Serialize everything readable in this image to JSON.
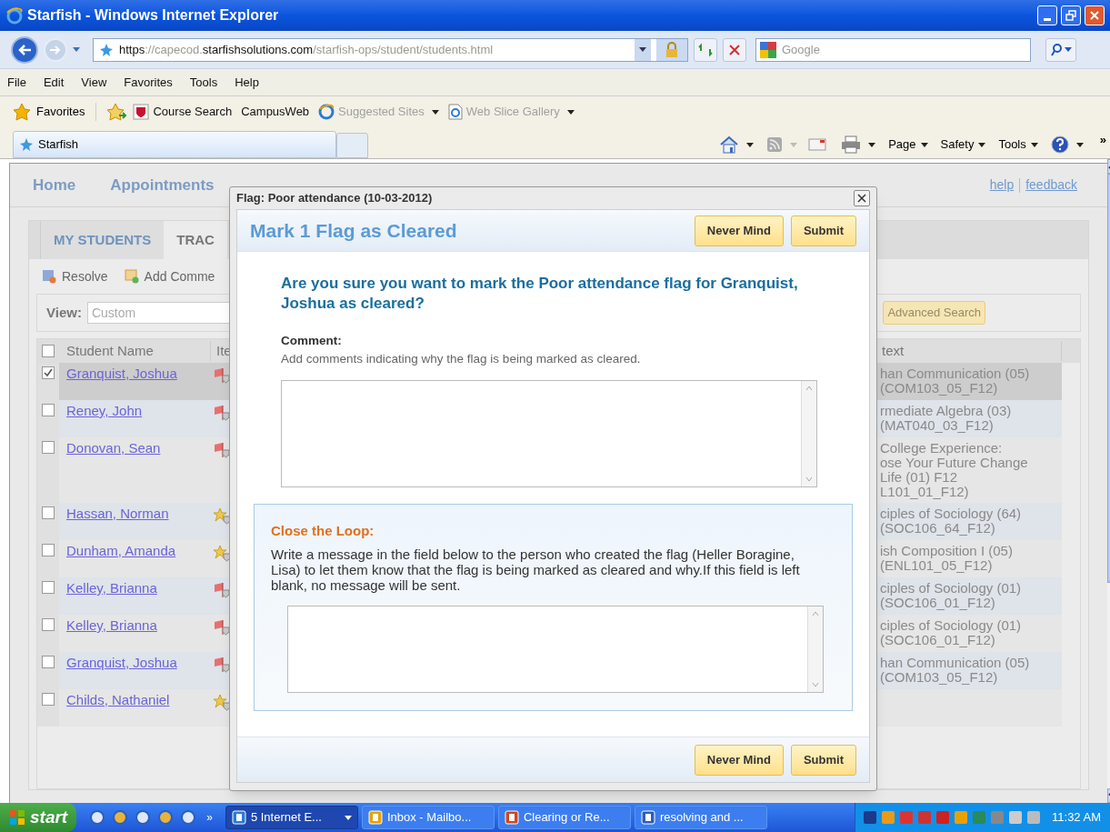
{
  "browser": {
    "title": "Starfish - Windows Internet Explorer",
    "address": [
      {
        "text": "https",
        "emphasis": true
      },
      {
        "text": "://capecod.",
        "emphasis": false
      },
      {
        "text": "starfishsolutions.com",
        "emphasis": true
      },
      {
        "text": "/starfish-ops/student/students.html",
        "emphasis": false
      }
    ],
    "search_placeholder": "Google",
    "menu": [
      "File",
      "Edit",
      "View",
      "Favorites",
      "Tools",
      "Help"
    ],
    "favorites_label": "Favorites",
    "favorites": [
      {
        "label": "Course Search",
        "kind": "shield",
        "disabled": false,
        "dropdown": false
      },
      {
        "label": "CampusWeb",
        "kind": "plain",
        "disabled": false,
        "dropdown": false
      },
      {
        "label": "Suggested Sites",
        "kind": "ie",
        "disabled": true,
        "dropdown": true
      },
      {
        "label": "Web Slice Gallery",
        "kind": "page",
        "disabled": true,
        "dropdown": true
      }
    ],
    "tabs": [
      {
        "label": "Starfish",
        "selected": true
      }
    ],
    "commands": [
      "Page",
      "Safety",
      "Tools"
    ],
    "overflow": "»"
  },
  "page": {
    "nav": [
      "Home",
      "Appointments"
    ],
    "links": [
      "help",
      "feedback"
    ],
    "tabs": [
      {
        "label": "MY STUDENTS",
        "selected": false
      },
      {
        "label": "TRAC",
        "selected": true
      }
    ],
    "actions": [
      {
        "label": "Resolve",
        "kind": "resolve"
      },
      {
        "label": "Add Comme",
        "kind": "comment"
      }
    ],
    "select_all_checked": false,
    "view_label": "View:",
    "view_value": "Custom",
    "advanced_search": "Advanced Search",
    "columns": [
      "Student Name",
      "Ite",
      "text"
    ],
    "rows": [
      {
        "name": "Granquist, Joshua",
        "checked": true,
        "selected": true,
        "kind": "flag",
        "context": [
          "han Communication (05)",
          "(COM103_05_F12)"
        ]
      },
      {
        "name": "Reney, John",
        "checked": false,
        "selected": false,
        "kind": "flag",
        "context": [
          "rmediate Algebra (03)",
          "(MAT040_03_F12)"
        ]
      },
      {
        "name": "Donovan, Sean",
        "checked": false,
        "selected": false,
        "kind": "flag",
        "context": [
          "College Experience:",
          "ose Your Future Change",
          "Life (01) F12",
          "L101_01_F12)"
        ]
      },
      {
        "name": "Hassan, Norman",
        "checked": false,
        "selected": false,
        "kind": "kudos",
        "context": [
          "ciples of Sociology (64)",
          "(SOC106_64_F12)"
        ]
      },
      {
        "name": "Dunham, Amanda",
        "checked": false,
        "selected": false,
        "kind": "kudos",
        "context": [
          "ish Composition I (05)",
          "(ENL101_05_F12)"
        ]
      },
      {
        "name": "Kelley, Brianna",
        "checked": false,
        "selected": false,
        "kind": "flag",
        "context": [
          "ciples of Sociology (01)",
          "(SOC106_01_F12)"
        ]
      },
      {
        "name": "Kelley, Brianna",
        "checked": false,
        "selected": false,
        "kind": "flag",
        "context": [
          "ciples of Sociology (01)",
          "(SOC106_01_F12)"
        ]
      },
      {
        "name": "Granquist, Joshua",
        "checked": false,
        "selected": false,
        "kind": "flag",
        "context": [
          "han Communication (05)",
          "(COM103_05_F12)"
        ]
      },
      {
        "name": "Childs, Nathaniel",
        "checked": false,
        "selected": false,
        "kind": "kudos",
        "context": []
      }
    ]
  },
  "dialog": {
    "title": "Flag: Poor attendance (10-03-2012)",
    "heading": "Mark 1 Flag as Cleared",
    "buttons": [
      "Never Mind",
      "Submit"
    ],
    "question": "Are you sure you want to mark the Poor attendance flag for Granquist, Joshua as cleared?",
    "comment_label": "Comment:",
    "comment_hint": "Add comments indicating why the flag is being marked as cleared.",
    "loop_title": "Close the Loop:",
    "loop_message": "Write a message in the field below to the person who created the flag (Heller Boragine, Lisa) to let them know that the flag is being marked as cleared and why.If this field is left blank, no message will be sent.",
    "footer_buttons": [
      "Never Mind",
      "Submit"
    ]
  },
  "taskbar": {
    "start": "start",
    "overflow": "»",
    "tasks": [
      {
        "label": "5 Internet E...",
        "kind": "ie",
        "selected": true
      },
      {
        "label": "Inbox - Mailbo...",
        "kind": "outlook",
        "selected": false
      },
      {
        "label": "Clearing or Re...",
        "kind": "ppt",
        "selected": false
      },
      {
        "label": "resolving and ...",
        "kind": "word",
        "selected": false
      }
    ],
    "clock": "11:32 AM"
  }
}
